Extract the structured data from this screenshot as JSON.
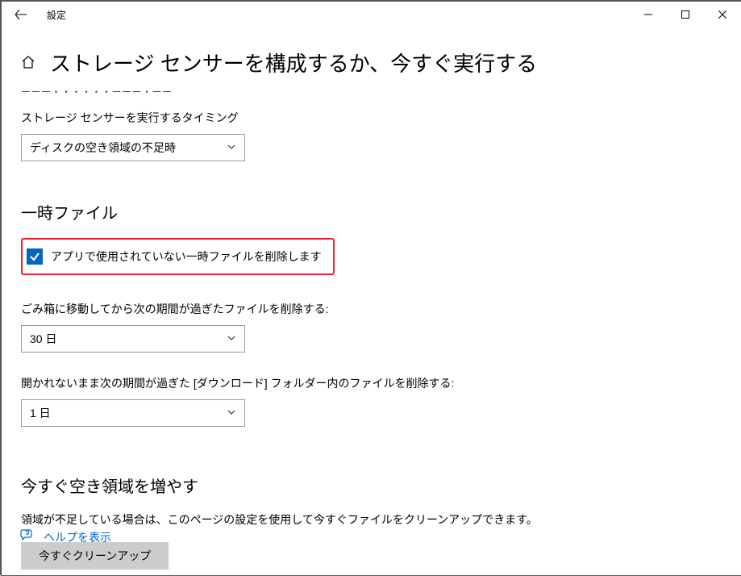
{
  "titlebar": {
    "title": "設定"
  },
  "header": {
    "page_title": "ストレージ センサーを構成するか、今すぐ実行する"
  },
  "obscured_line": "ーーー・・・・・・ーーー・ーー",
  "timing": {
    "label": "ストレージ センサーを実行するタイミング",
    "selected": "ディスクの空き領域の不足時"
  },
  "temp_files": {
    "heading": "一時ファイル",
    "checkbox_checked": true,
    "checkbox_label": "アプリで使用されていない一時ファイルを削除します",
    "recycle_label": "ごみ箱に移動してから次の期間が過ぎたファイルを削除する:",
    "recycle_selected": "30 日",
    "downloads_label": "開かれないまま次の期間が過ぎた [ダウンロード] フォルダー内のファイルを削除する:",
    "downloads_selected": "1 日"
  },
  "free_now": {
    "heading": "今すぐ空き領域を増やす",
    "description": "領域が不足している場合は、このページの設定を使用して今すぐファイルをクリーンアップできます。",
    "button": "今すぐクリーンアップ"
  },
  "help": {
    "link": "ヘルプを表示"
  }
}
